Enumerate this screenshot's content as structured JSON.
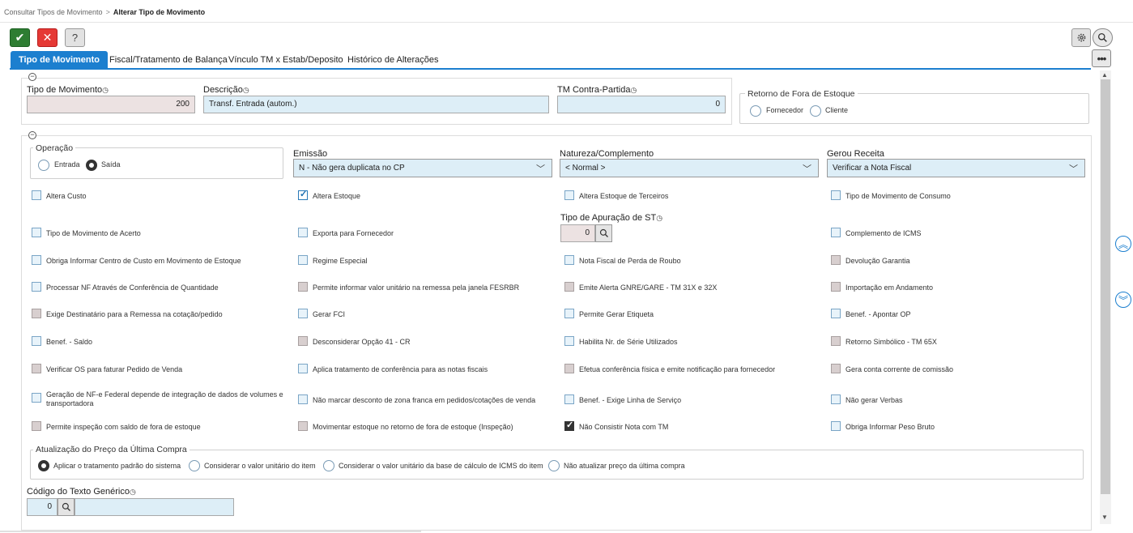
{
  "breadcrumb": {
    "parent": "Consultar Tipos de Movimento",
    "separator": ">",
    "current": "Alterar Tipo de Movimento"
  },
  "toolbar": {
    "ok_glyph": "✔",
    "cancel_glyph": "✕",
    "help_glyph": "?",
    "more_glyph": "•••"
  },
  "tabs": [
    "Tipo de Movimento",
    "Fiscal/Tratamento de Balança",
    "Vínculo TM x Estab/Deposito",
    "Histórico de Alterações"
  ],
  "header": {
    "collapse_glyph": "−",
    "tipo_label": "Tipo de Movimento",
    "tipo_value": "200",
    "descricao_label": "Descrição",
    "descricao_value": "Transf. Entrada (autom.)",
    "contra_label": "TM Contra-Partida",
    "contra_value": "0",
    "retorno_title": "Retorno de Fora de Estoque",
    "retorno_options": [
      "Fornecedor",
      "Cliente"
    ]
  },
  "field_note_glyph": "◷",
  "operacao": {
    "title": "Operação",
    "options": [
      "Entrada",
      "Saída"
    ],
    "selected": "Saída"
  },
  "emissao": {
    "label": "Emissão",
    "value": "N - Não gera duplicata no CP"
  },
  "natureza": {
    "label": "Natureza/Complemento",
    "value": "< Normal >"
  },
  "gerou": {
    "label": "Gerou Receita",
    "value": "Verificar a Nota Fiscal"
  },
  "apuracao": {
    "label": "Tipo de Apuração de ST",
    "value": "0"
  },
  "checkboxes": [
    "Altera Custo",
    "Altera Estoque",
    "Altera Estoque de Terceiros",
    "Tipo de Movimento de Consumo",
    "Tipo de Movimento de Acerto",
    "Exporta para Fornecedor",
    "Complemento de ICMS",
    "Obriga Informar Centro de Custo em Movimento de Estoque",
    "Regime Especial",
    "Nota Fiscal de Perda de Roubo",
    "Devolução Garantia",
    "Processar NF Através de Conferência de Quantidade",
    "Permite informar valor unitário na remessa pela janela FESRBR",
    "Emite Alerta GNRE/GARE - TM 31X e 32X",
    "Importação em Andamento",
    "Exige Destinatário para a Remessa na cotação/pedido",
    "Gerar FCI",
    "Permite Gerar Etiqueta",
    "Benef. - Apontar OP",
    "Benef. - Saldo",
    "Desconsiderar Opção 41 - CR",
    "Habilita Nr. de Série Utilizados",
    "Retorno Simbólico - TM 65X",
    "Verificar OS para faturar Pedido de Venda",
    "Aplica tratamento de conferência para as notas fiscais",
    "Efetua conferência física e emite notificação para fornecedor",
    "Gera conta corrente de comissão",
    "Geração de NF-e Federal depende de integração de dados de volumes e transportadora",
    "Não marcar desconto de zona franca em pedidos/cotações de venda",
    "Benef. - Exige Linha de Serviço",
    "Não gerar Verbas",
    "Permite inspeção com saldo de fora de estoque",
    "Movimentar estoque no retorno de fora de estoque (Inspeção)",
    "Não Consistir Nota com TM",
    "Obriga Informar Peso Bruto"
  ],
  "atualizacao": {
    "title": "Atualização do Preço da Última Compra",
    "options": [
      "Aplicar o tratamento padrão do sistema",
      "Considerar o valor unitário do item",
      "Considerar o valor unitário da base de cálculo de ICMS do item",
      "Não atualizar preço da última compra"
    ]
  },
  "texto": {
    "label": "Código do Texto Genérico",
    "value": "0"
  },
  "colors": {
    "accent": "#1c7fcf",
    "ok": "#2e7d32",
    "cancel": "#e53935"
  }
}
